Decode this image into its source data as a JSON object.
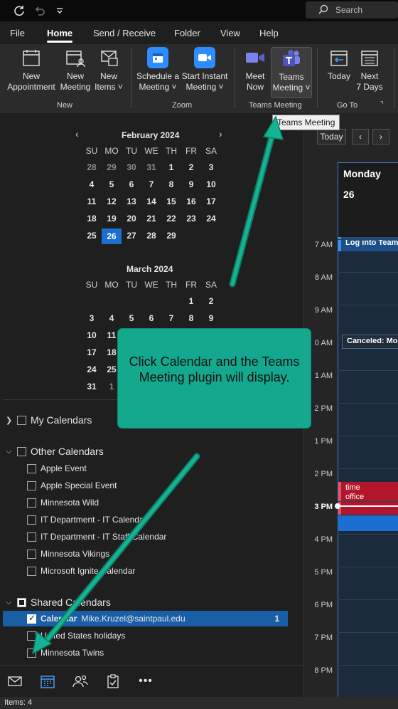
{
  "titlebar": {
    "search_label": "Search",
    "icons": [
      "sync-icon",
      "undo-icon",
      "customize-quick-access-icon",
      "search-icon"
    ]
  },
  "menu": {
    "tabs": [
      "File",
      "Home",
      "Send / Receive",
      "Folder",
      "View",
      "Help"
    ],
    "active": "Home"
  },
  "ribbon": {
    "new_appointment": [
      "New",
      "Appointment"
    ],
    "new_meeting": [
      "New",
      "Meeting"
    ],
    "new_items": [
      "New",
      "Items ˅"
    ],
    "group_new": "New",
    "schedule_meeting": [
      "Schedule a",
      "Meeting ˅"
    ],
    "start_instant_meeting": [
      "Start Instant",
      "Meeting ˅"
    ],
    "group_zoom": "Zoom",
    "meet_now": [
      "Meet",
      "Now"
    ],
    "teams_meeting": [
      "Teams",
      "Meeting ˅"
    ],
    "group_teams": "Teams Meeting",
    "today": "Today",
    "next_7_days": [
      "Next",
      "7 Days"
    ],
    "group_goto": "Go To",
    "tooltip": "Teams Meeting",
    "colors": {
      "zoom_blue": "#2d8cff",
      "teams_purple": "#5b5fc7",
      "today_highlight": "#1a6fd0"
    }
  },
  "mini_calendar": {
    "feb": {
      "title": "February 2024",
      "days": [
        "SU",
        "MO",
        "TU",
        "WE",
        "TH",
        "FR",
        "SA"
      ],
      "weeks": [
        [
          "28",
          "29",
          "30",
          "31",
          "1",
          "2",
          "3"
        ],
        [
          "4",
          "5",
          "6",
          "7",
          "8",
          "9",
          "10"
        ],
        [
          "11",
          "12",
          "13",
          "14",
          "15",
          "16",
          "17"
        ],
        [
          "18",
          "19",
          "20",
          "21",
          "22",
          "23",
          "24"
        ],
        [
          "25",
          "26",
          "27",
          "28",
          "29",
          "",
          ""
        ]
      ],
      "today": "26"
    },
    "mar": {
      "title": "March 2024",
      "days": [
        "SU",
        "MO",
        "TU",
        "WE",
        "TH",
        "FR",
        "SA"
      ],
      "weeks": [
        [
          "",
          "",
          "",
          "",
          "",
          "1",
          "2"
        ],
        [
          "3",
          "4",
          "5",
          "6",
          "7",
          "8",
          "9"
        ],
        [
          "10",
          "11",
          "",
          "",
          "",
          "",
          ""
        ],
        [
          "17",
          "18",
          "",
          "",
          "",
          "",
          ""
        ],
        [
          "24",
          "25",
          "",
          "",
          "",
          "",
          ""
        ],
        [
          "31",
          "1",
          "",
          "",
          "",
          "",
          ""
        ]
      ]
    },
    "prev": "‹",
    "next": "›"
  },
  "calendars": {
    "my": "My Calendars",
    "other": "Other Calendars",
    "other_items": [
      "Apple Event",
      "Apple Special Event",
      "Minnesota Wild",
      "IT Department - IT Calendar",
      "IT Department - IT Staff Calendar",
      "Minnesota Vikings",
      "Microsoft Ignite Calendar"
    ],
    "shared": "Shared Calendars",
    "shared_selected": {
      "name": "Calendar",
      "owner": "Mike.Kruzel@saintpaul.edu",
      "count": "1"
    },
    "shared_items": [
      "United States holidays",
      "Minnesota Twins"
    ]
  },
  "bottom_nav": [
    "mail-icon",
    "calendar-icon",
    "people-icon",
    "tasks-icon",
    "more-icon"
  ],
  "status": {
    "items": "Items: 4"
  },
  "day_view": {
    "today_btn": "Today",
    "prev_btn": "‹",
    "next_btn": "›",
    "day_name": "Monday",
    "day_num": "26",
    "hours": [
      "7 AM",
      "8 AM",
      "9 AM",
      "0 AM",
      "1 AM",
      "2 PM",
      "1 PM",
      "2 PM",
      "3 PM",
      "4 PM",
      "5 PM",
      "6 PM",
      "7 PM",
      "8 PM"
    ],
    "now_hour": "3 PM",
    "events": {
      "log_into_teams": "Log into Team",
      "canceled": "Canceled: Mon",
      "time": "time",
      "office": "office"
    }
  },
  "annotation": {
    "text": "Click Calendar and the Teams Meeting plugin will display."
  }
}
